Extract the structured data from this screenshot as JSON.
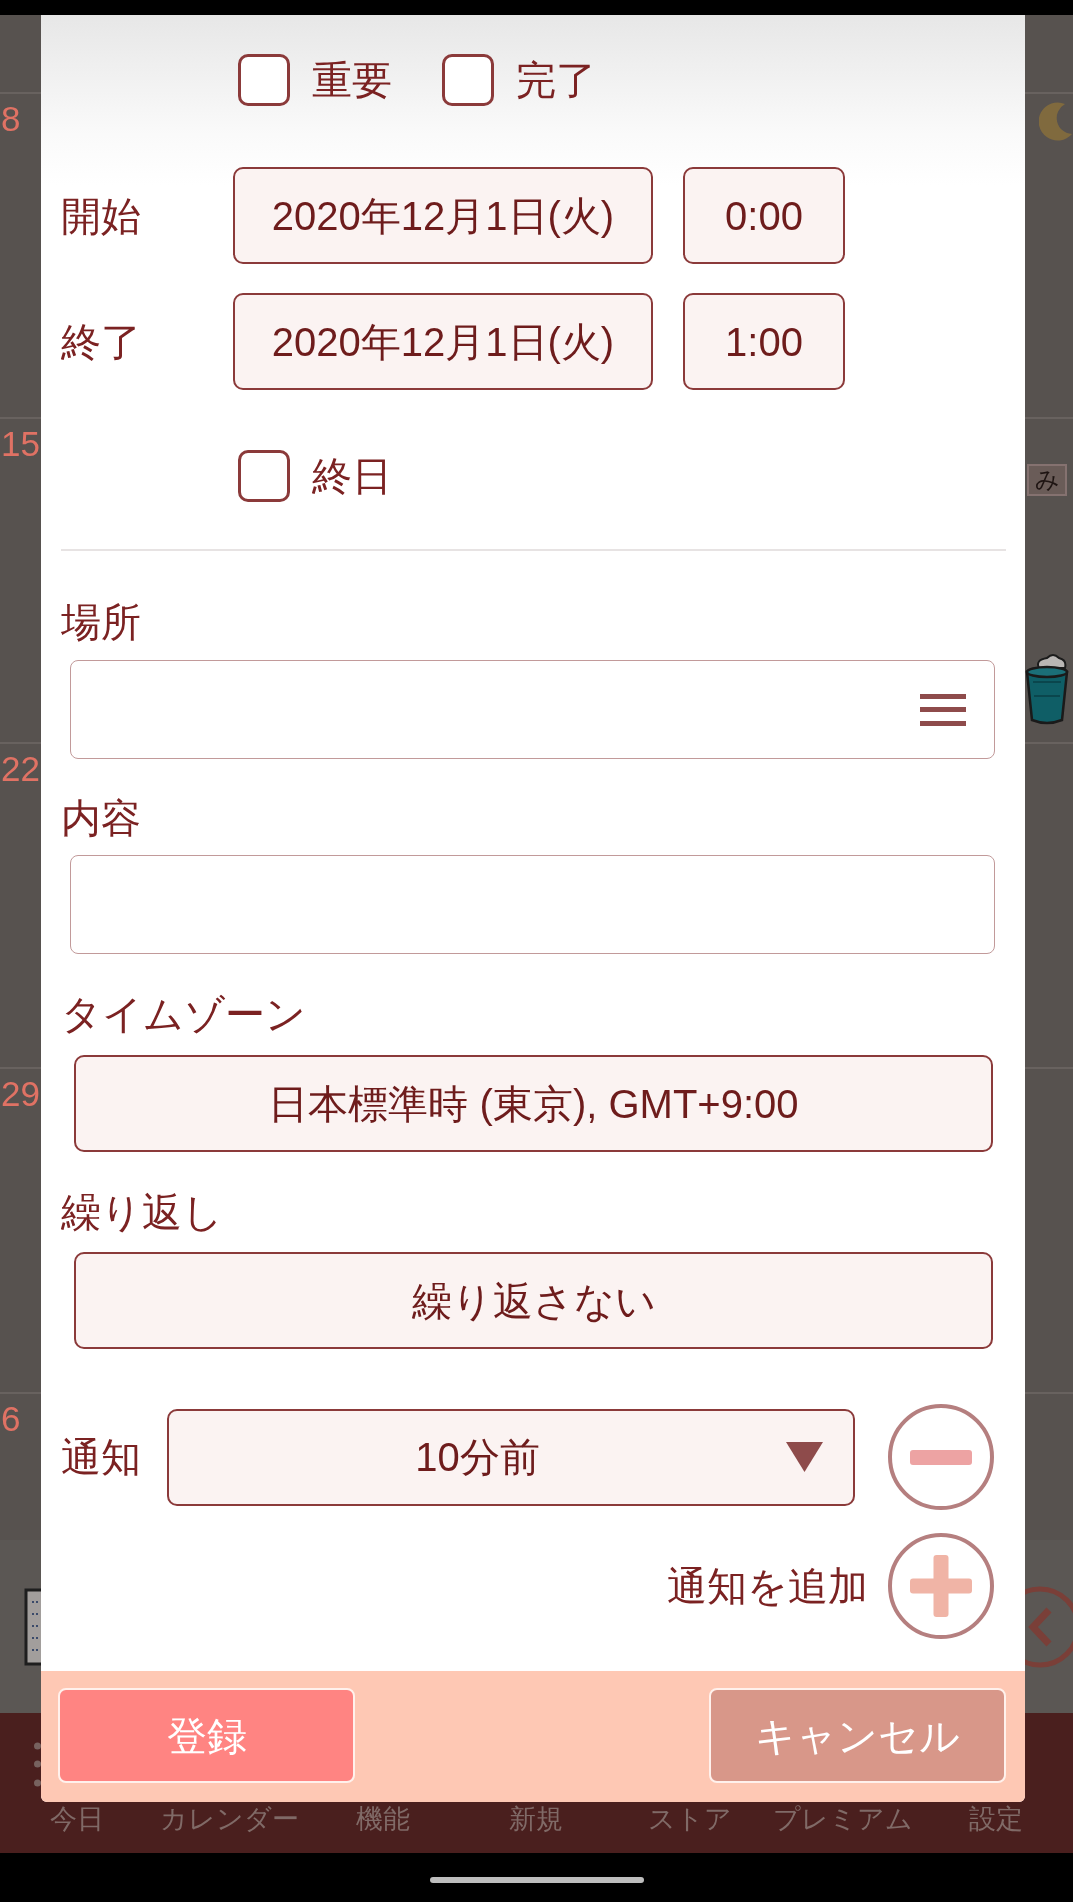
{
  "background": {
    "weeks": [
      {
        "day": "8"
      },
      {
        "day": "15",
        "tag": "み"
      },
      {
        "day": "22"
      },
      {
        "day": "29"
      },
      {
        "day": "6"
      }
    ],
    "bottom_nav": [
      "今日",
      "カレンダー",
      "機能",
      "新規",
      "ストア",
      "プレミアム",
      "設定"
    ]
  },
  "dialog": {
    "flags": [
      {
        "label": "重要",
        "checked": false
      },
      {
        "label": "完了",
        "checked": false
      }
    ],
    "start": {
      "label": "開始",
      "date": "2020年12月1日(火)",
      "time": "0:00"
    },
    "end": {
      "label": "終了",
      "date": "2020年12月1日(火)",
      "time": "1:00"
    },
    "all_day": {
      "label": "終日",
      "checked": false
    },
    "location": {
      "label": "場所"
    },
    "content": {
      "label": "内容"
    },
    "timezone": {
      "label": "タイムゾーン",
      "value": "日本標準時 (東京), GMT+9:00"
    },
    "repeat": {
      "label": "繰り返し",
      "value": "繰り返さない"
    },
    "notifications": [
      {
        "label": "通知",
        "value": "10分前"
      }
    ],
    "add_notification": {
      "label": "通知を追加"
    },
    "buttons": [
      {
        "label": "登録",
        "kind": "primary"
      },
      {
        "label": "キャンセル",
        "kind": "secondary"
      }
    ]
  }
}
